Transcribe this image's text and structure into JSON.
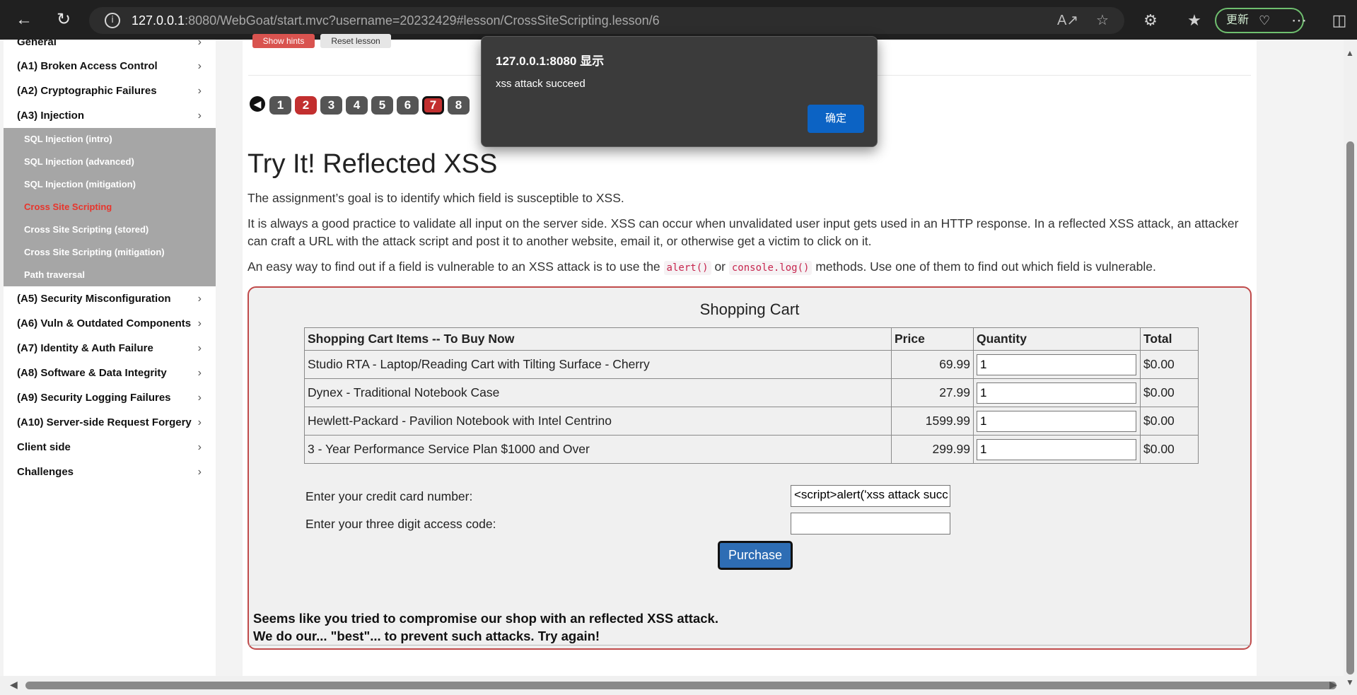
{
  "browser": {
    "url_host": "127.0.0.1",
    "url_rest": ":8080/WebGoat/start.mvc?username=20232429#lesson/CrossSiteScripting.lesson/6",
    "update_label": "更新"
  },
  "sidebar": {
    "top_partial": "General",
    "categories_before": [
      "(A1) Broken Access Control",
      "(A2) Cryptographic Failures",
      "(A3) Injection"
    ],
    "sub_items": [
      "SQL Injection (intro)",
      "SQL Injection (advanced)",
      "SQL Injection (mitigation)",
      "Cross Site Scripting",
      "Cross Site Scripting (stored)",
      "Cross Site Scripting (mitigation)",
      "Path traversal"
    ],
    "categories_after": [
      "(A5) Security Misconfiguration",
      "(A6) Vuln & Outdated Components",
      "(A7) Identity & Auth Failure",
      "(A8) Software & Data Integrity",
      "(A9) Security Logging Failures",
      "(A10) Server-side Request Forgery",
      "Client side",
      "Challenges"
    ]
  },
  "lesson": {
    "show_hints": "Show hints",
    "reset_lesson": "Reset lesson",
    "pages": [
      "1",
      "2",
      "3",
      "4",
      "5",
      "6",
      "7",
      "8"
    ],
    "title": "Try It! Reflected XSS",
    "para1": "The assignment’s goal is to identify which field is susceptible to XSS.",
    "para2": "It is always a good practice to validate all input on the server side. XSS can occur when unvalidated user input gets used in an HTTP response. In a reflected XSS attack, an attacker can craft a URL with the attack script and post it to another website, email it, or otherwise get a victim to click on it.",
    "para3_pre": "An easy way to find out if a field is vulnerable to an XSS attack is to use the",
    "code1": "alert()",
    "para3_or": "or",
    "code2": "console.log()",
    "para3_post": "methods. Use one of them to find out which field is vulnerable."
  },
  "cart": {
    "title": "Shopping Cart",
    "headers": [
      "Shopping Cart Items -- To Buy Now",
      "Price",
      "Quantity",
      "Total"
    ],
    "rows": [
      {
        "item": "Studio RTA - Laptop/Reading Cart with Tilting Surface - Cherry",
        "price": "69.99",
        "qty": "1",
        "total": "$0.00"
      },
      {
        "item": "Dynex - Traditional Notebook Case",
        "price": "27.99",
        "qty": "1",
        "total": "$0.00"
      },
      {
        "item": "Hewlett-Packard - Pavilion Notebook with Intel Centrino",
        "price": "1599.99",
        "qty": "1",
        "total": "$0.00"
      },
      {
        "item": "3 - Year Performance Service Plan $1000 and Over",
        "price": "299.99",
        "qty": "1",
        "total": "$0.00"
      }
    ],
    "cc_label": "Enter your credit card number:",
    "cc_value": "<script>alert('xss attack succ",
    "code_label": "Enter your three digit access code:",
    "code_value": "",
    "purchase": "Purchase",
    "feedback1": "Seems like you tried to compromise our shop with an reflected XSS attack.",
    "feedback2": "We do our... \"best\"... to prevent such attacks. Try again!"
  },
  "dialog": {
    "title": "127.0.0.1:8080 显示",
    "message": "xss attack succeed",
    "ok": "确定"
  }
}
